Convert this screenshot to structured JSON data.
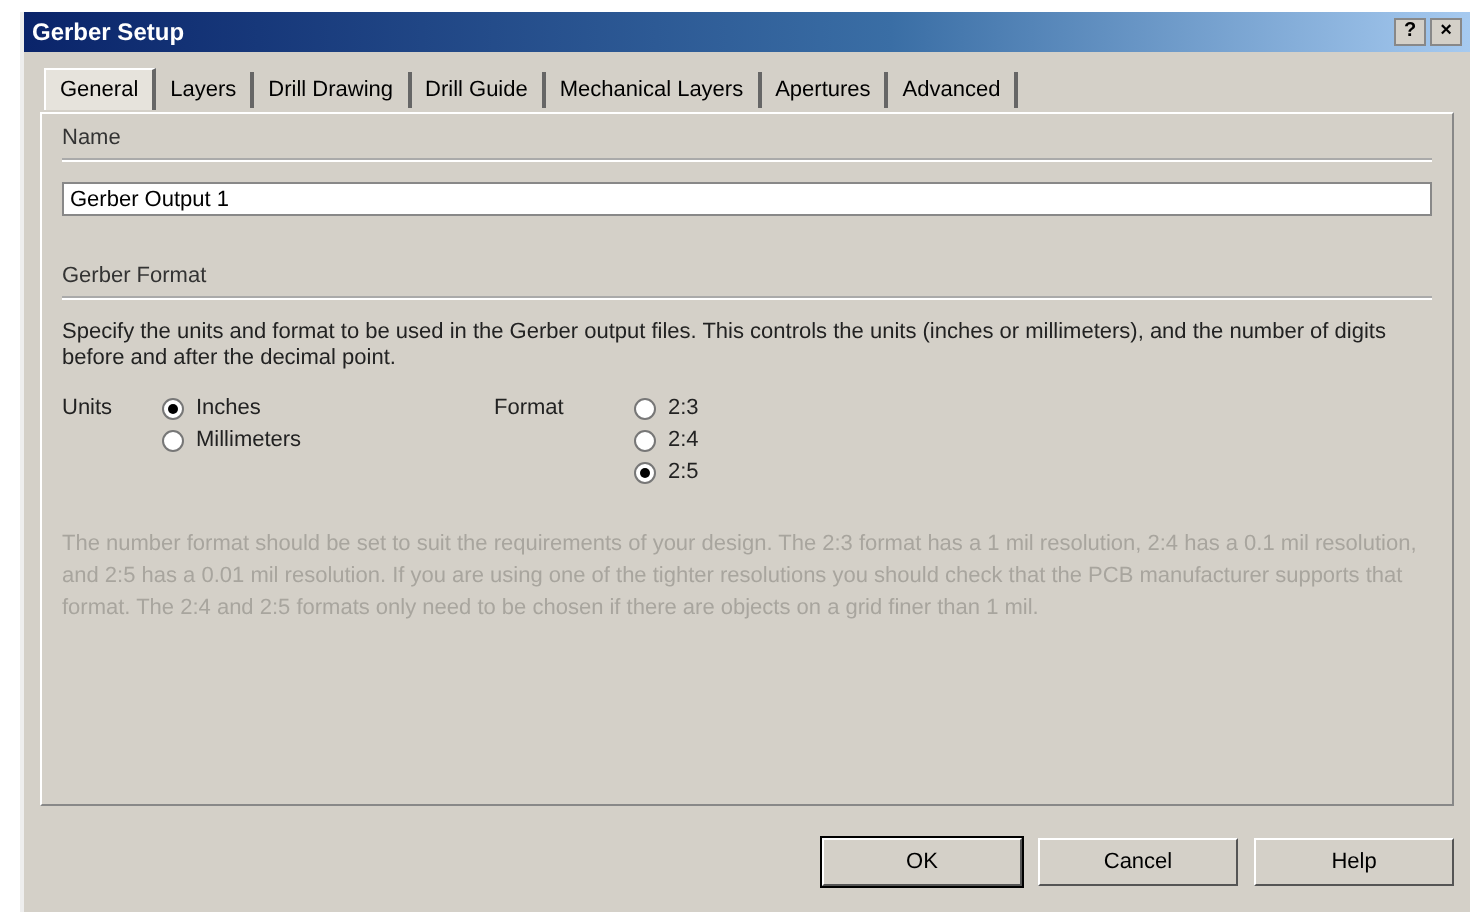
{
  "window": {
    "title": "Gerber Setup",
    "title_buttons": [
      "?",
      "×"
    ]
  },
  "tabs": [
    {
      "label": "General",
      "selected": true
    },
    {
      "label": "Layers",
      "selected": false
    },
    {
      "label": "Drill Drawing",
      "selected": false
    },
    {
      "label": "Drill Guide",
      "selected": false
    },
    {
      "label": "Mechanical Layers",
      "selected": false
    },
    {
      "label": "Apertures",
      "selected": false
    },
    {
      "label": "Advanced",
      "selected": false
    }
  ],
  "name_section": {
    "heading": "Name",
    "value": "Gerber Output 1"
  },
  "format_section": {
    "heading": "Gerber Format",
    "description": "Specify the units and format to be used in the Gerber output files. This controls the units (inches or millimeters), and the number of digits before and after the decimal point.",
    "units": {
      "label": "Units",
      "options": [
        {
          "label": "Inches",
          "selected": true
        },
        {
          "label": "Millimeters",
          "selected": false
        }
      ]
    },
    "format": {
      "label": "Format",
      "options": [
        {
          "label": "2:3",
          "selected": false
        },
        {
          "label": "2:4",
          "selected": false
        },
        {
          "label": "2:5",
          "selected": true
        }
      ]
    },
    "note": {
      "text": "The number format should be set to suit the requirements of your design. The 2:3 format has a 1 mil resolution, 2:4 has a 0.1 mil resolution, and 2:5 has a 0.01 mil resolution. If you are using one of the tighter resolutions you should check that the PCB manufacturer supports that format. The 2:4 and 2:5 formats only need to be chosen if there are objects on a grid finer than 1 mil.",
      "disabled": true
    }
  },
  "buttons": [
    {
      "label": "OK",
      "default": true
    },
    {
      "label": "Cancel",
      "default": false
    },
    {
      "label": "Help",
      "default": false
    }
  ]
}
